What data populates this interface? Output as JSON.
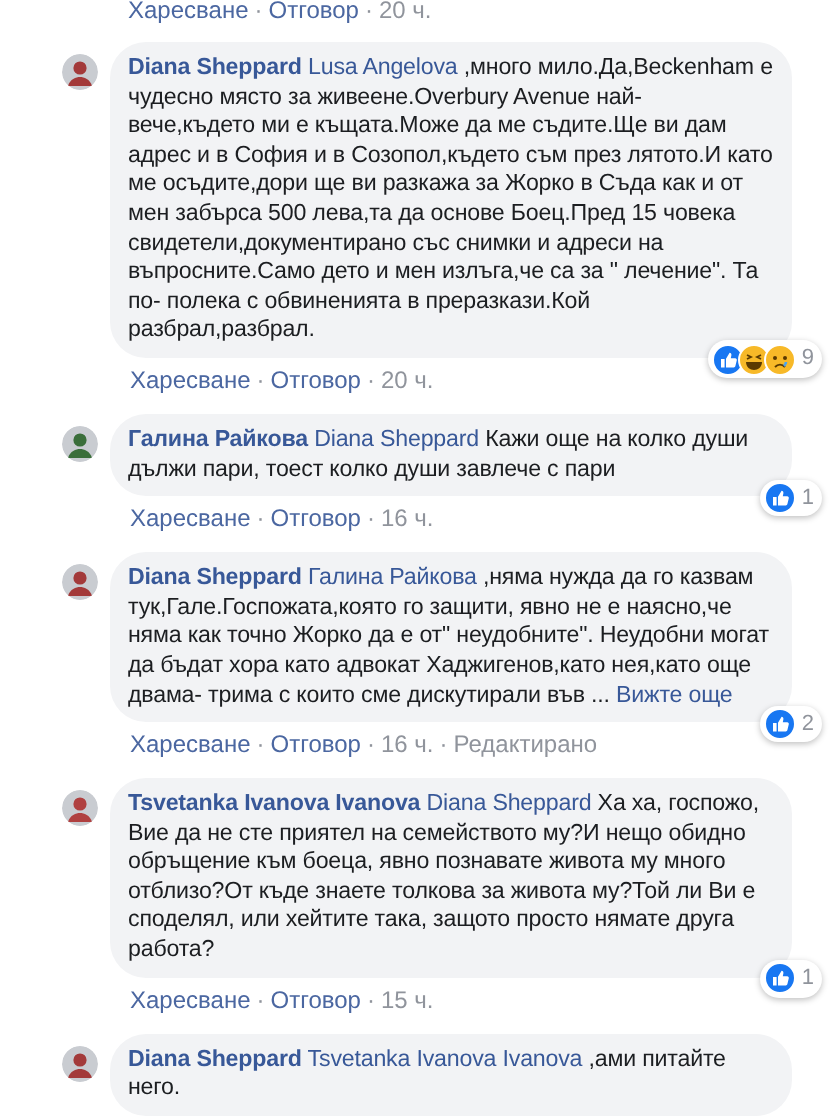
{
  "top_actions": {
    "like": "Харесване",
    "reply": "Отговор",
    "time": "20 ч.",
    "separator": "·"
  },
  "comments": [
    {
      "author": "Diana Sheppard",
      "mention": "Lusa Angelova",
      "text": " ,много мило.Да,Beckenham е чудесно място за живеене.Overbury Avenue най- вече,където ми е къщата.Може да ме съдите.Ще ви дам адрес и в София и в Созопол,където съм през лятото.И като ме осъдите,дори ще ви разкажа за Жорко в Съда как и от мен забърса 500 лева,та да основе Боец.Пред 15 човека свидетели,документирано със снимки и адреси на въпросните.Само дето и мен излъга,че са за \" лечение\". Та по- полека с обвиненията в преразкази.Кой разбрал,разбрал.",
      "reactions": {
        "icons": [
          {
            "kind": "like"
          },
          {
            "kind": "haha"
          },
          {
            "kind": "sad"
          }
        ],
        "count": "9"
      },
      "actions": {
        "like": "Харесване",
        "reply": "Отговор",
        "time": "20 ч.",
        "separator": "·"
      }
    },
    {
      "author": "Галина Райкова",
      "mention": "Diana Sheppard",
      "text": " Кажи още на колко души дължи пари, тоест колко души завлече с пари",
      "reactions": {
        "icons": [
          {
            "kind": "like"
          }
        ],
        "count": "1"
      },
      "actions": {
        "like": "Харесване",
        "reply": "Отговор",
        "time": "16 ч.",
        "separator": "·"
      }
    },
    {
      "author": "Diana Sheppard",
      "mention": "Галина Райкова",
      "text": " ,няма нужда да го казвам тук,Гале.Госпожата,която го защити, явно не е наясно,че няма как точно Жорко да е от\" неудобните\". Неудобни могат да бъдат хора като адвокат Хаджигенов,като нея,като още двама- трима с които сме дискутирали във ...",
      "see_more": "Вижте още",
      "reactions": {
        "icons": [
          {
            "kind": "like"
          }
        ],
        "count": "2"
      },
      "actions": {
        "like": "Харесване",
        "reply": "Отговор",
        "time": "16 ч.",
        "edited": "Редактирано",
        "separator": "·"
      }
    },
    {
      "author": "Tsvetanka Ivanova Ivanova",
      "mention": "Diana Sheppard",
      "text": " Ха ха, госпожо, Вие да не сте приятел на семейството му?И нещо обидно обръщение към боеца, явно познавате живота му много отблизо?От къде знаете толкова за живота му?Той ли Ви е споделял, или хейтите така, защото просто нямате друга работа?",
      "reactions": {
        "icons": [
          {
            "kind": "like"
          }
        ],
        "count": "1"
      },
      "actions": {
        "like": "Харесване",
        "reply": "Отговор",
        "time": "15 ч.",
        "separator": "·"
      }
    },
    {
      "author": "Diana Sheppard",
      "mention": "Tsvetanka Ivanova Ivanova",
      "text": " ,ами питайте него."
    }
  ]
}
